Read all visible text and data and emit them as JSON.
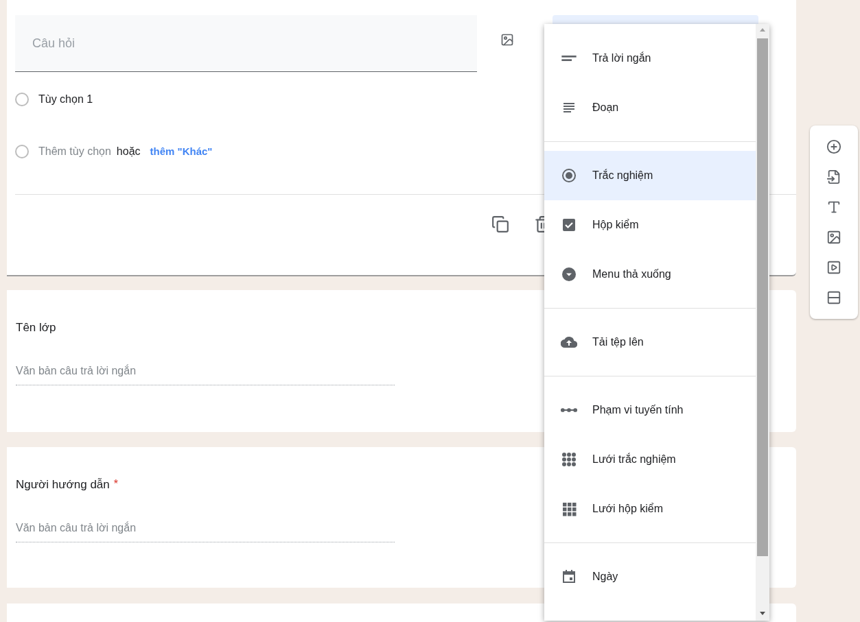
{
  "question_card": {
    "question_placeholder": "Câu hỏi",
    "options": [
      {
        "label": "Tùy chọn 1"
      }
    ],
    "add_option": {
      "text": "Thêm tùy chọn",
      "separator": "hoặc",
      "link": "thêm \"Khác\""
    }
  },
  "cards": [
    {
      "title": "Tên lớp",
      "placeholder": "Văn bản câu trả lời ngắn"
    },
    {
      "title": "Người hướng dẫn",
      "required_mark": "*",
      "placeholder": "Văn bản câu trả lời ngắn"
    }
  ],
  "type_menu": {
    "groups": [
      [
        {
          "kind": "short",
          "label": "Trả lời ngắn",
          "selected": false
        },
        {
          "kind": "paragraph",
          "label": "Đoạn",
          "selected": false
        }
      ],
      [
        {
          "kind": "radio",
          "label": "Trắc nghiệm",
          "selected": true
        },
        {
          "kind": "checkbox",
          "label": "Hộp kiểm",
          "selected": false
        },
        {
          "kind": "dropdown",
          "label": "Menu thả xuống",
          "selected": false
        }
      ],
      [
        {
          "kind": "upload",
          "label": "Tải tệp lên",
          "selected": false
        }
      ],
      [
        {
          "kind": "scale",
          "label": "Phạm vi tuyến tính",
          "selected": false
        },
        {
          "kind": "radio_grid",
          "label": "Lưới trắc nghiệm",
          "selected": false
        },
        {
          "kind": "checkbox_grid",
          "label": "Lưới hộp kiểm",
          "selected": false
        }
      ],
      [
        {
          "kind": "date",
          "label": "Ngày",
          "selected": false
        }
      ]
    ]
  }
}
